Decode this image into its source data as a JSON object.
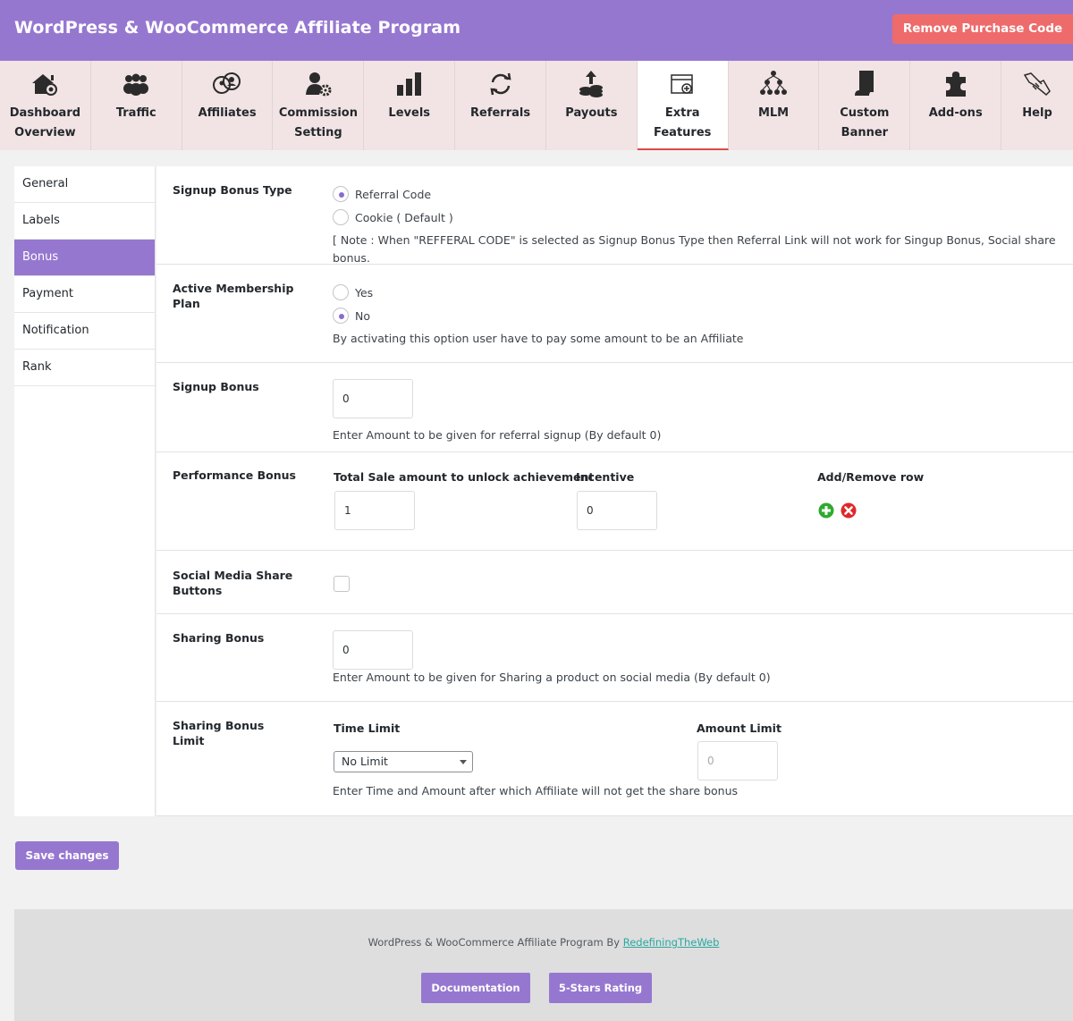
{
  "header": {
    "title": "WordPress & WooCommerce Affiliate Program",
    "remove_button": "Remove Purchase Code"
  },
  "tabs": [
    {
      "line1": "Dashboard",
      "line2": "Overview",
      "icon": "home-icon"
    },
    {
      "line1": "Traffic",
      "line2": "",
      "icon": "users-group-icon"
    },
    {
      "line1": "Affiliates",
      "line2": "",
      "icon": "affiliates-icon"
    },
    {
      "line1": "Commission",
      "line2": "Setting",
      "icon": "user-gear-icon"
    },
    {
      "line1": "Levels",
      "line2": "",
      "icon": "bar-chart-icon"
    },
    {
      "line1": "Referrals",
      "line2": "",
      "icon": "refresh-icon"
    },
    {
      "line1": "Payouts",
      "line2": "",
      "icon": "coins-upload-icon"
    },
    {
      "line1": "Extra",
      "line2": "Features",
      "icon": "browser-plus-icon"
    },
    {
      "line1": "MLM",
      "line2": "",
      "icon": "network-icon"
    },
    {
      "line1": "Custom",
      "line2": "Banner",
      "icon": "banner-icon"
    },
    {
      "line1": "Add-ons",
      "line2": "",
      "icon": "puzzle-icon"
    },
    {
      "line1": "Help",
      "line2": "",
      "icon": "handshake-icon"
    }
  ],
  "active_tab": "Extra Features",
  "sidebar": {
    "items": [
      "General",
      "Labels",
      "Bonus",
      "Payment",
      "Notification",
      "Rank"
    ],
    "active": "Bonus"
  },
  "signup_bonus_type": {
    "label": "Signup Bonus Type",
    "options": [
      "Referral Code",
      "Cookie ( Default )"
    ],
    "selected": "Referral Code",
    "note": "[ Note : When \"REFFERAL CODE\" is selected as Signup Bonus Type then Referral Link will not work for Singup Bonus, Social share bonus."
  },
  "active_membership": {
    "label": "Active Membership Plan",
    "options": [
      "Yes",
      "No"
    ],
    "selected": "No",
    "note": "By activating this option user have to pay some amount to be an Affiliate"
  },
  "signup_bonus": {
    "label": "Signup Bonus",
    "value": "0",
    "note": "Enter Amount to be given for referral signup (By default 0)"
  },
  "performance_bonus": {
    "label": "Performance Bonus",
    "col_sale": "Total Sale amount to unlock achievement",
    "col_incentive": "Incentive",
    "col_addremove": "Add/Remove row",
    "sale_value": "1",
    "incentive_value": "0"
  },
  "social_share": {
    "label": "Social Media Share Buttons",
    "checked": false
  },
  "sharing_bonus": {
    "label": "Sharing Bonus",
    "value": "0",
    "note": "Enter Amount to be given for Sharing a product on social media (By default 0)"
  },
  "sharing_limit": {
    "label": "Sharing Bonus Limit",
    "time_label": "Time Limit",
    "time_value": "No Limit",
    "amount_label": "Amount Limit",
    "amount_placeholder": "0",
    "note": "Enter Time and Amount after which Affiliate will not get the share bonus"
  },
  "save_button": "Save changes",
  "footer": {
    "credit_text": "WordPress & WooCommerce Affiliate Program By ",
    "credit_link": "RedefiningTheWeb",
    "doc_button": "Documentation",
    "rating_button": "5-Stars Rating"
  },
  "colors": {
    "brand": "#9677d0",
    "danger": "#ee6b6b",
    "add": "#2eaa2e",
    "remove": "#e02828"
  }
}
